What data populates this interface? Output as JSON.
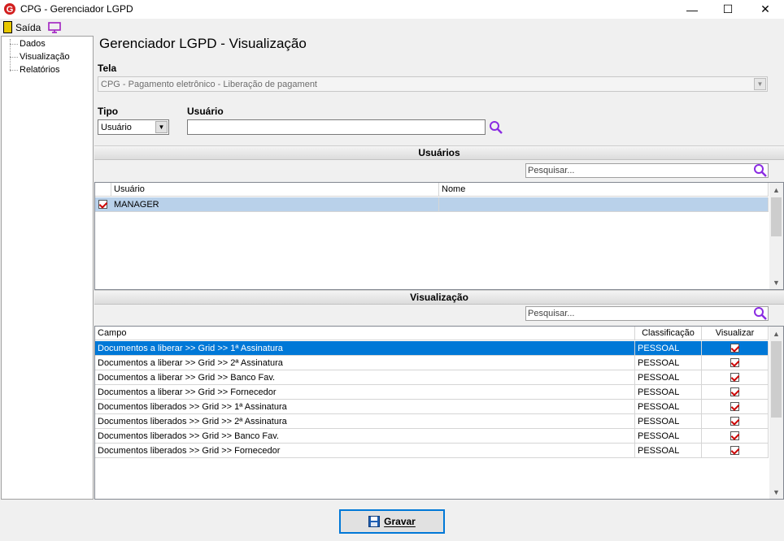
{
  "window": {
    "title": "CPG - Gerenciador LGPD",
    "minimize": "—",
    "maximize": "☐",
    "close": "✕"
  },
  "menu": {
    "exit_label": "Saída"
  },
  "tree": {
    "items": [
      "Dados",
      "Visualização",
      "Relatórios"
    ]
  },
  "page_title": "Gerenciador LGPD - Visualização",
  "tela": {
    "label": "Tela",
    "value": "CPG - Pagamento eletrônico - Liberação de pagament"
  },
  "tipo": {
    "label": "Tipo",
    "value": "Usuário"
  },
  "usuario": {
    "label": "Usuário",
    "value": ""
  },
  "users_section": {
    "title": "Usuários",
    "search_placeholder": "Pesquisar...",
    "columns": [
      "Usuário",
      "Nome"
    ],
    "rows": [
      {
        "checked": true,
        "usuario": "MANAGER",
        "nome": ""
      }
    ]
  },
  "view_section": {
    "title": "Visualização",
    "search_placeholder": "Pesquisar...",
    "columns": [
      "Campo",
      "Classificação",
      "Visualizar"
    ],
    "rows": [
      {
        "campo": "Documentos a liberar >> Grid >> 1ª Assinatura",
        "classificacao": "PESSOAL",
        "visualizar": true
      },
      {
        "campo": "Documentos a liberar >> Grid >> 2ª Assinatura",
        "classificacao": "PESSOAL",
        "visualizar": true
      },
      {
        "campo": "Documentos a liberar >> Grid >> Banco Fav.",
        "classificacao": "PESSOAL",
        "visualizar": true
      },
      {
        "campo": "Documentos a liberar >> Grid >> Fornecedor",
        "classificacao": "PESSOAL",
        "visualizar": true
      },
      {
        "campo": "Documentos liberados >> Grid >> 1ª Assinatura",
        "classificacao": "PESSOAL",
        "visualizar": true
      },
      {
        "campo": "Documentos liberados >> Grid >> 2ª Assinatura",
        "classificacao": "PESSOAL",
        "visualizar": true
      },
      {
        "campo": "Documentos liberados >> Grid >> Banco Fav.",
        "classificacao": "PESSOAL",
        "visualizar": true
      },
      {
        "campo": "Documentos liberados >> Grid >> Fornecedor",
        "classificacao": "PESSOAL",
        "visualizar": true
      }
    ]
  },
  "save_button": {
    "label": "Gravar"
  },
  "colors": {
    "accent": "#0078d7",
    "search_icon": "#8a2be2",
    "check": "#cc0000"
  }
}
